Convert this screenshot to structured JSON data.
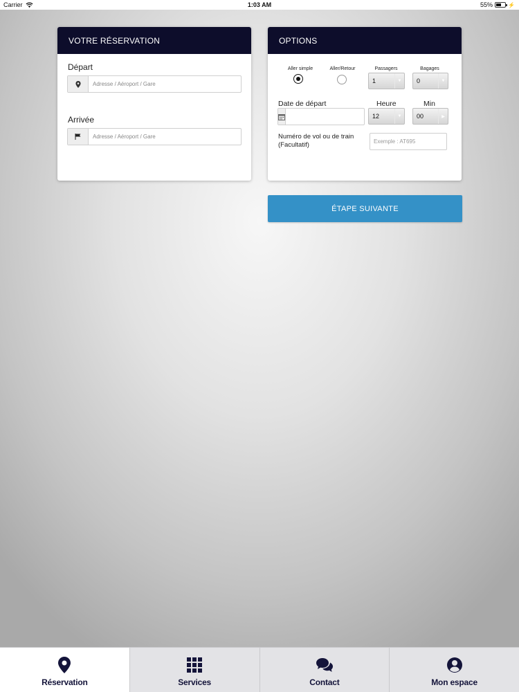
{
  "status_bar": {
    "carrier": "Carrier",
    "time": "1:03 AM",
    "battery": "55%"
  },
  "reservation": {
    "title": "VOTRE RÉSERVATION",
    "departure_label": "Départ",
    "departure_placeholder": "Adresse / Aéroport / Gare",
    "arrival_label": "Arrivée",
    "arrival_placeholder": "Adresse / Aéroport / Gare"
  },
  "options": {
    "title": "OPTIONS",
    "one_way_label": "Aller simple",
    "round_trip_label": "Aller/Retour",
    "passengers_label": "Passagers",
    "passengers_value": "1",
    "luggage_label": "Bagages",
    "luggage_value": "0",
    "date_label": "Date de départ",
    "date_value": "",
    "hour_label": "Heure",
    "hour_value": "12",
    "minute_label": "Min",
    "minute_value": "00",
    "flight_label": "Numéro de vol ou de train (Facultatif)",
    "flight_placeholder": "Exemple : AT695"
  },
  "next_button": "ÉTAPE SUIVANTE",
  "tabs": [
    {
      "label": "Réservation",
      "icon": "map-pin-icon"
    },
    {
      "label": "Services",
      "icon": "grid-icon"
    },
    {
      "label": "Contact",
      "icon": "chat-icon"
    },
    {
      "label": "Mon espace",
      "icon": "user-icon"
    }
  ],
  "colors": {
    "header": "#0d0d2b",
    "accent": "#3491c7",
    "tab_text": "#14143a"
  }
}
